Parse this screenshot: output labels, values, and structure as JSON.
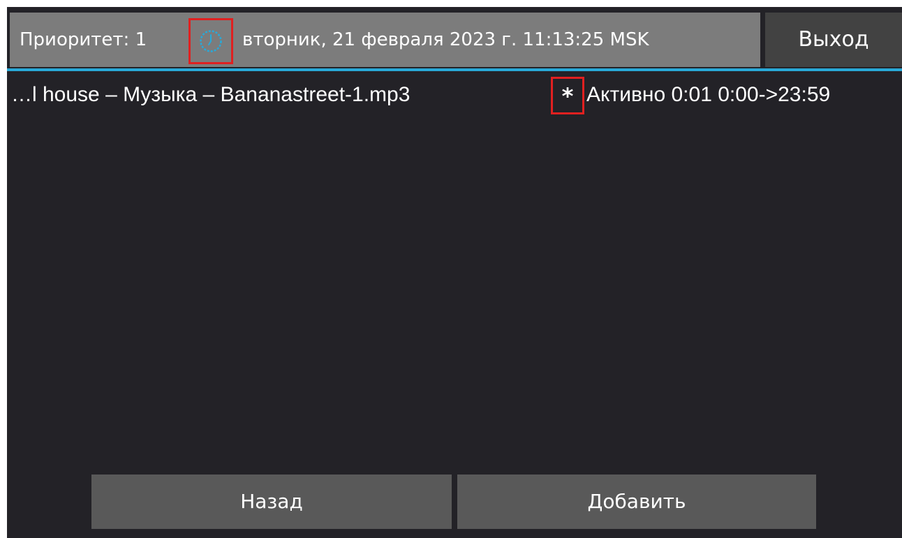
{
  "status_bar": {
    "priority_label": "Приоритет: 1",
    "clock_icon": "clock-icon",
    "datetime": "вторник, 21 февраля 2023 г. 11:13:25 MSK"
  },
  "header": {
    "exit_label": "Выход"
  },
  "playlist": {
    "items": [
      {
        "name": "…l house – Музыка – Bananastreet-1.mp3",
        "marker": "*",
        "status": "Активно 0:01 0:00->23:59"
      }
    ]
  },
  "footer": {
    "back_label": "Назад",
    "add_label": "Добавить"
  },
  "colors": {
    "background": "#232227",
    "status_bar": "#7c7c7c",
    "exit_button": "#424242",
    "bottom_buttons": "#595959",
    "accent": "#29a9d8",
    "highlight_box": "#e02020",
    "text": "#ffffff"
  }
}
